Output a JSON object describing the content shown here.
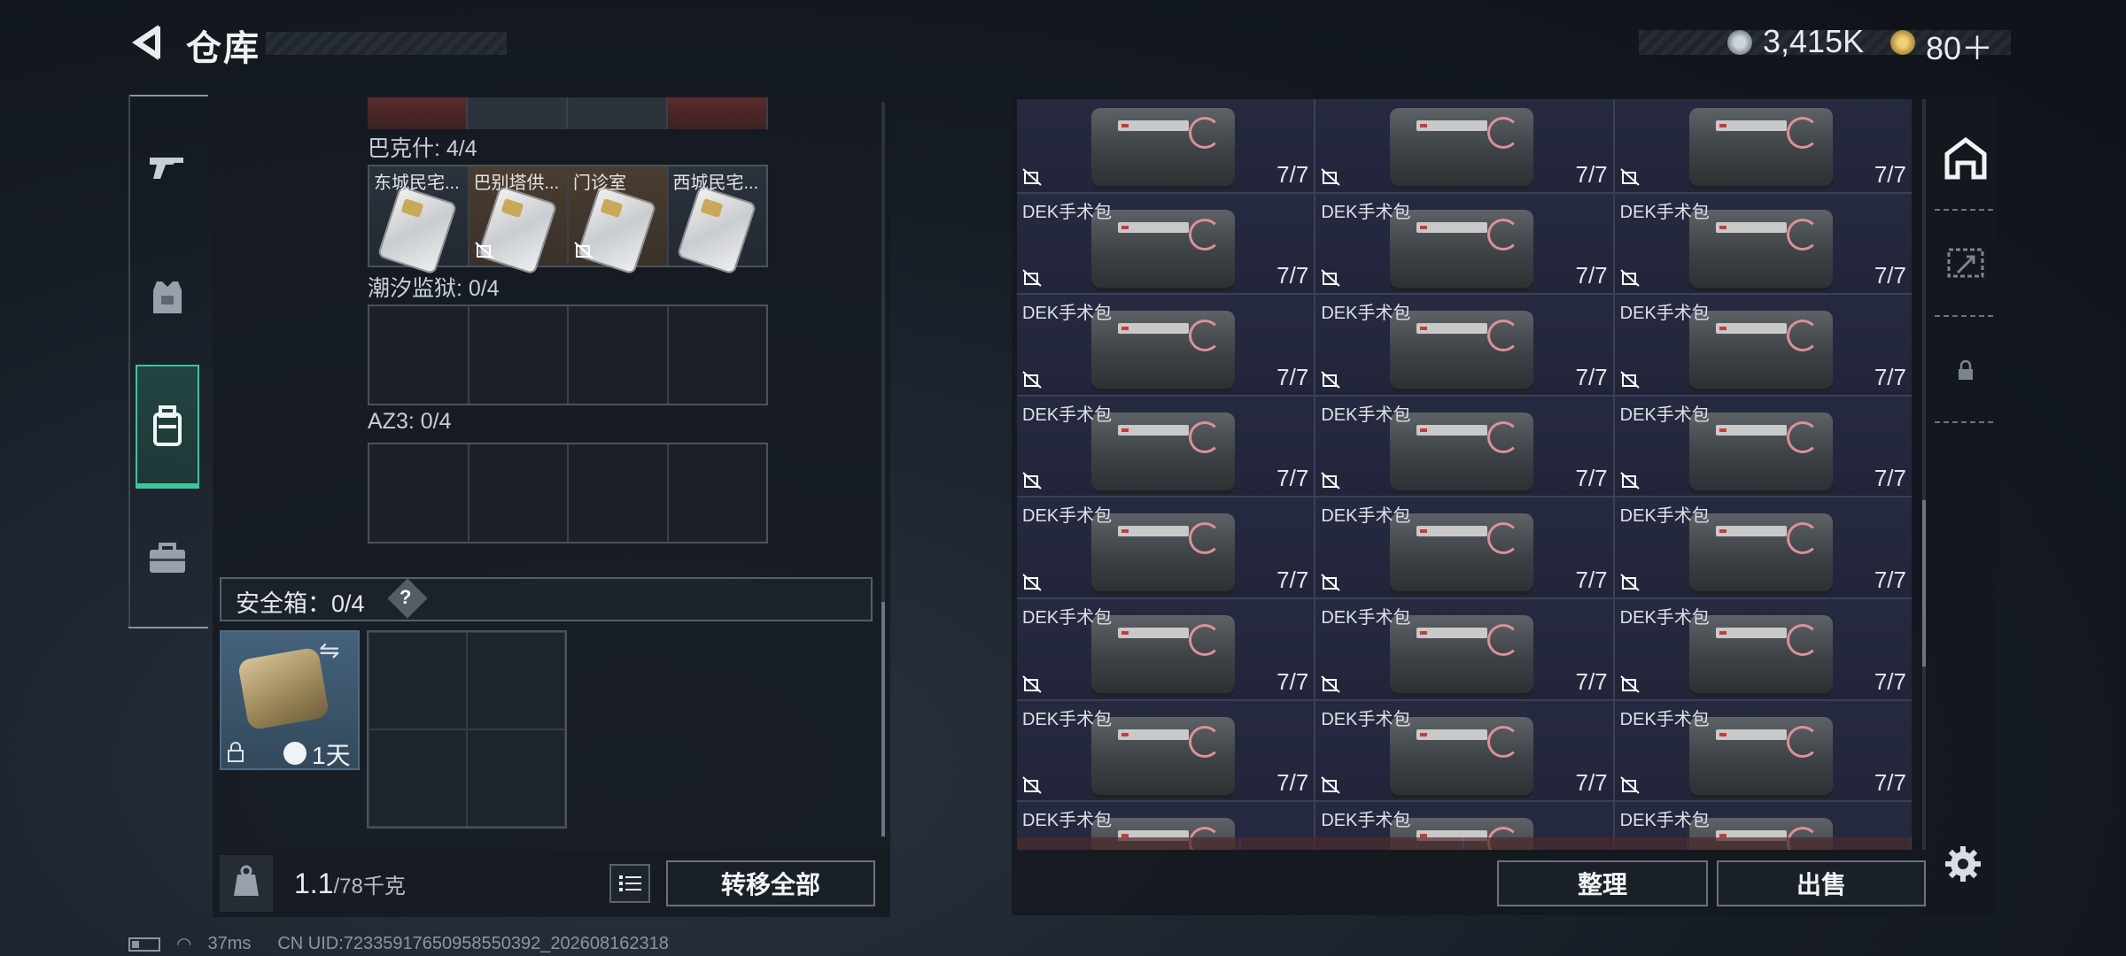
{
  "header": {
    "title": "仓库",
    "currency": "3,415K",
    "tokens": "80＋"
  },
  "nav": {
    "items": [
      {
        "name": "weapons",
        "icon": "pistol-icon"
      },
      {
        "name": "armor",
        "icon": "armor-vest-icon"
      },
      {
        "name": "backpack",
        "icon": "backpack-icon",
        "active": true
      },
      {
        "name": "case",
        "icon": "briefcase-icon"
      }
    ]
  },
  "left": {
    "sections": [
      {
        "label": "巴克什: 4/4",
        "cards": [
          "东城民宅...",
          "巴别塔供...",
          "门诊室",
          "西城民宅..."
        ]
      },
      {
        "label": "潮汐监狱: 0/4"
      },
      {
        "label": "AZ3: 0/4"
      }
    ],
    "safe_box": {
      "label": "安全箱：0/4",
      "help": "?",
      "duration": "1天"
    }
  },
  "bottom": {
    "weight_value": "1.1",
    "weight_max": "/78千克",
    "transfer_label": "转移全部"
  },
  "right": {
    "item_name": "DEK手术包",
    "item_count": "7/7",
    "rows": 8,
    "cols": 3,
    "sort_label": "整理",
    "sell_label": "出售"
  },
  "status": {
    "ping": "37ms",
    "uid": "CN UID:72335917650958550392_202608162318"
  },
  "colors": {
    "accent": "#3ec79a",
    "panel": "#22263a",
    "button_border": "#6a737d"
  }
}
